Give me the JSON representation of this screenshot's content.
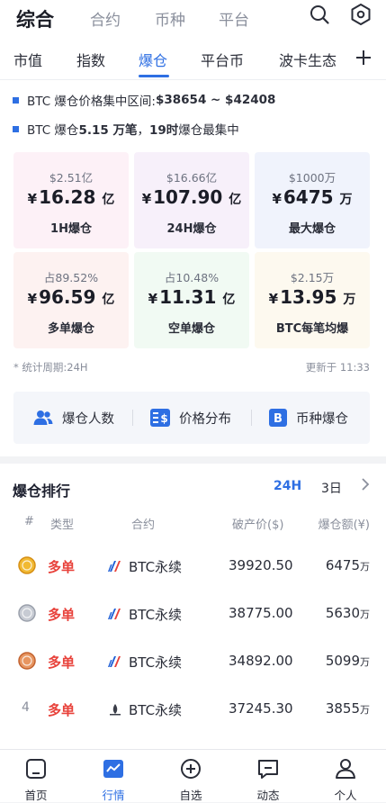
{
  "top_tabs": [
    {
      "label": "综合",
      "active": true
    },
    {
      "label": "合约",
      "active": false
    },
    {
      "label": "币种",
      "active": false
    },
    {
      "label": "平台",
      "active": false
    }
  ],
  "sub_tabs": [
    {
      "label": "市值",
      "active": false
    },
    {
      "label": "指数",
      "active": false
    },
    {
      "label": "爆仓",
      "active": true
    },
    {
      "label": "平台币",
      "active": false
    },
    {
      "label": "波卡生态",
      "active": false
    }
  ],
  "info": {
    "line1_prefix": "BTC 爆仓价格集中区间: ",
    "line1_range": "$38654 ~ $42408",
    "line2_prefix": "BTC 爆仓 ",
    "line2_count": "5.15 万笔",
    "line2_mid": "，",
    "line2_hour": "19时",
    "line2_suffix": " 爆仓最集中"
  },
  "stats": [
    {
      "small": "$2.51亿",
      "currency": "¥",
      "value": "16.28",
      "unit": "亿",
      "label": "1H爆仓",
      "bg": "#fdf1f7"
    },
    {
      "small": "$16.66亿",
      "currency": "¥",
      "value": "107.90",
      "unit": "亿",
      "label": "24H爆仓",
      "bg": "#f7f0fa"
    },
    {
      "small": "$1000万",
      "currency": "¥",
      "value": "6475",
      "unit": "万",
      "label": "最大爆仓",
      "bg": "#f0f3fc"
    },
    {
      "small": "占89.52%",
      "currency": "¥",
      "value": "96.59",
      "unit": "亿",
      "label": "多单爆仓",
      "bg": "#fdf2f1"
    },
    {
      "small": "占10.48%",
      "currency": "¥",
      "value": "11.31",
      "unit": "亿",
      "label": "空单爆仓",
      "bg": "#f1faf3"
    },
    {
      "small": "$2.15万",
      "currency": "¥",
      "value": "13.95",
      "unit": "万",
      "label": "BTC每笔均爆",
      "bg": "#fdf9ef"
    }
  ],
  "footer": {
    "period": "* 统计周期:24H",
    "updated": "更新于 11:33"
  },
  "tools": [
    {
      "label": "爆仓人数",
      "icon": "users-icon"
    },
    {
      "label": "价格分布",
      "icon": "price-distribution-icon"
    },
    {
      "label": "币种爆仓",
      "icon": "coin-b-icon"
    }
  ],
  "ranking": {
    "title": "爆仓排行",
    "range_24h": "24H",
    "range_3d": "3日",
    "headers": [
      "#",
      "类型",
      "合约",
      "破产价($)",
      "爆仓额(¥)"
    ],
    "rows": [
      {
        "rank": "1",
        "medal": "gold",
        "type": "多单",
        "contract": "BTC永续",
        "price": "39920.50",
        "amount": "6475",
        "unit": "万",
        "exchange": "huobi"
      },
      {
        "rank": "2",
        "medal": "silver",
        "type": "多单",
        "contract": "BTC永续",
        "price": "38775.00",
        "amount": "5630",
        "unit": "万",
        "exchange": "huobi"
      },
      {
        "rank": "3",
        "medal": "bronze",
        "type": "多单",
        "contract": "BTC永续",
        "price": "34892.00",
        "amount": "5099",
        "unit": "万",
        "exchange": "huobi"
      },
      {
        "rank": "4",
        "medal": "",
        "type": "多单",
        "contract": "BTC永续",
        "price": "37245.30",
        "amount": "3855",
        "unit": "万",
        "exchange": "okex"
      }
    ]
  },
  "bottom_nav": [
    {
      "label": "首页",
      "icon": "home-icon",
      "active": false
    },
    {
      "label": "行情",
      "icon": "market-chart-icon",
      "active": true
    },
    {
      "label": "自选",
      "icon": "add-circle-icon",
      "active": false
    },
    {
      "label": "动态",
      "icon": "message-icon",
      "active": false
    },
    {
      "label": "个人",
      "icon": "person-icon",
      "active": false
    }
  ],
  "colors": {
    "accent": "#2e6fe3",
    "long": "#e8413a",
    "text": "#1e2130",
    "muted": "#8a8f9c"
  }
}
